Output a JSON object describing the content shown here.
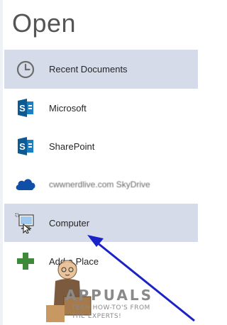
{
  "title": "Open",
  "places": [
    {
      "label": "Recent Documents",
      "icon": "clock-icon",
      "selected": true
    },
    {
      "label": "Microsoft",
      "icon": "sharepoint-icon",
      "selected": false
    },
    {
      "label": "SharePoint",
      "icon": "sharepoint-icon",
      "selected": false
    },
    {
      "label": "cwwnerdlive.com SkyDrive",
      "icon": "onedrive-cloud-icon",
      "selected": false
    },
    {
      "label": "Computer",
      "icon": "computer-icon",
      "selected": true
    },
    {
      "label": "Add a Place",
      "icon": "plus-icon",
      "selected": false
    }
  ],
  "watermark": {
    "name": "APPUALS",
    "tagline_line1": "TECH HOW-TO'S FROM",
    "tagline_line2": "THE EXPERTS!"
  },
  "colors": {
    "selection": "#d6dbe9",
    "sharepoint_blue": "#0b72b5",
    "onedrive_blue": "#1565c0",
    "arrow_blue": "#1a22c8",
    "plus_green": "#3e8a3a"
  }
}
